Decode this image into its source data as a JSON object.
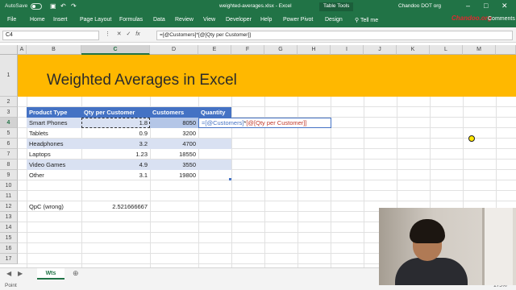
{
  "titlebar": {
    "autosave": "AutoSave",
    "autosave_state": "Off",
    "document": "weighted-averages.xlsx  -  Excel",
    "context_tools": "Table Tools",
    "user": "Chandoo DOT org"
  },
  "ribbon": {
    "tabs": [
      "File",
      "Home",
      "Insert",
      "Page Layout",
      "Formulas",
      "Data",
      "Review",
      "View",
      "Developer",
      "Help",
      "Power Pivot",
      "Design"
    ],
    "tell_me": "Tell me",
    "comments": "Comments",
    "watermark": "Chandoo.org"
  },
  "formula_bar": {
    "name_box": "C4",
    "formula": "=[@Customers]*[@[Qty per Customer]]"
  },
  "columns": [
    "A",
    "B",
    "C",
    "D",
    "E",
    "F",
    "G",
    "H",
    "I",
    "J",
    "K",
    "L",
    "M"
  ],
  "rows": [
    "1",
    "2",
    "3",
    "4",
    "5",
    "6",
    "7",
    "8",
    "9",
    "10",
    "11",
    "12",
    "13",
    "14",
    "15",
    "16",
    "17"
  ],
  "banner_title": "Weighted Averages in Excel",
  "table": {
    "headers": [
      "Product Type",
      "Qty per Customer",
      "Customers",
      "Quantity"
    ],
    "rows": [
      [
        "Smart Phones",
        "1.8",
        "8050",
        ""
      ],
      [
        "Tablets",
        "0.9",
        "3200",
        ""
      ],
      [
        "Headphones",
        "3.2",
        "4700",
        ""
      ],
      [
        "Laptops",
        "1.23",
        "18550",
        ""
      ],
      [
        "Video Games",
        "4.9",
        "3550",
        ""
      ],
      [
        "Other",
        "3.1",
        "19800",
        ""
      ]
    ],
    "editing_formula_part1": "=[@Customers]",
    "editing_formula_op": "*",
    "editing_formula_part2": "[@[Qty per Customer]]"
  },
  "summary": {
    "label": "QpC (wrong)",
    "value": "2.521666667"
  },
  "sheet_tabs": [
    "Wts"
  ],
  "status": {
    "mode": "Point",
    "zoom": "175%"
  },
  "colors": {
    "excel_green": "#217346",
    "banner": "#ffb800",
    "table_header": "#4472c4",
    "table_band": "#d9e1f2"
  }
}
